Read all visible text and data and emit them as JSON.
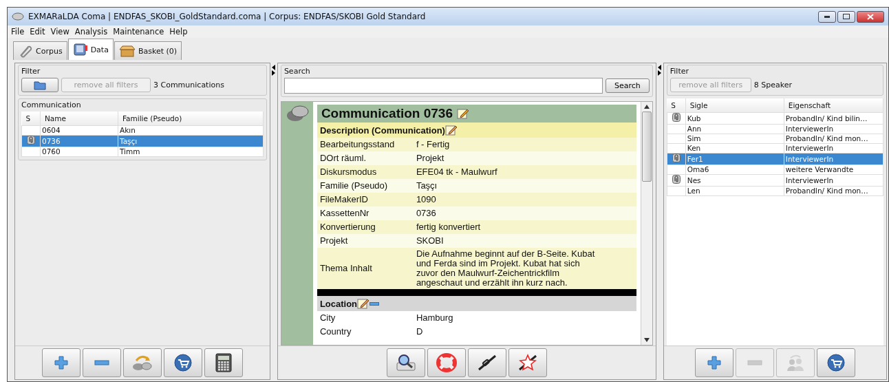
{
  "window": {
    "title": "EXMARaLDA Coma | ENDFAS_SKOBI_GoldStandard.coma | Corpus: ENDFAS/SKOBI Gold Standard"
  },
  "menu": [
    "File",
    "Edit",
    "View",
    "Analysis",
    "Maintenance",
    "Help"
  ],
  "tabs": [
    {
      "label": "Corpus",
      "kind": "clip",
      "selected": false
    },
    {
      "label": "Data",
      "kind": "book",
      "selected": true
    },
    {
      "label": "Basket (0)",
      "kind": "box",
      "selected": false
    }
  ],
  "left_panel": {
    "filter": {
      "title": "Filter",
      "remove_button": "remove all filters",
      "count": "3 Communications"
    },
    "communication": {
      "title": "Communication",
      "columns": [
        "S",
        "Name",
        "Familie (Pseudo)"
      ],
      "rows": [
        {
          "marked": false,
          "name": "0604",
          "family": "Akın",
          "selected": false
        },
        {
          "marked": true,
          "name": "0736",
          "family": "Taşçı",
          "selected": true
        },
        {
          "marked": false,
          "name": "0760",
          "family": "Timm",
          "selected": false
        }
      ]
    },
    "buttons": [
      {
        "kind": "add",
        "disabled": false
      },
      {
        "kind": "remove",
        "disabled": false
      },
      {
        "kind": "merge",
        "disabled": false
      },
      {
        "kind": "basket",
        "disabled": false
      },
      {
        "kind": "calculator",
        "disabled": false
      }
    ]
  },
  "center_panel": {
    "search": {
      "title": "Search",
      "button": "Search"
    },
    "detail": {
      "title": "Communication 0736",
      "sections": [
        {
          "kind": "description",
          "title": "Description (Communication)",
          "rows": [
            {
              "label": "Bearbeitungsstand",
              "value": "f - Fertig"
            },
            {
              "label": "DOrt räuml.",
              "value": "Projekt"
            },
            {
              "label": "Diskursmodus",
              "value": "EFE04 tk - Maulwurf"
            },
            {
              "label": "Familie (Pseudo)",
              "value": "Taşçı"
            },
            {
              "label": "FileMakerID",
              "value": "1090"
            },
            {
              "label": "KassettenNr",
              "value": "0736"
            },
            {
              "label": "Konvertierung",
              "value": "fertig konvertiert"
            },
            {
              "label": "Projekt",
              "value": "SKOBI"
            },
            {
              "label": "Thema Inhalt",
              "value": "Die Aufnahme beginnt auf der B-Seite. Kubat und Ferda sind im Projekt. Kubat hat sich zuvor den Maulwurf-Zeichentrickfilm angeschaut und erzählt ihn kurz nach."
            }
          ]
        },
        {
          "kind": "location",
          "title": "Location",
          "rows": [
            {
              "label": "City",
              "value": "Hamburg"
            },
            {
              "label": "Country",
              "value": "D"
            }
          ]
        }
      ]
    },
    "buttons": [
      {
        "kind": "search-doc",
        "disabled": false
      },
      {
        "kind": "lifebuoy",
        "disabled": false
      },
      {
        "kind": "chain",
        "disabled": false
      },
      {
        "kind": "broken-chain",
        "disabled": false
      }
    ]
  },
  "right_panel": {
    "filter": {
      "title": "Filter",
      "remove_button": "remove all filters",
      "count": "8 Speaker"
    },
    "columns": [
      "S",
      "Sigle",
      "Eigenschaft"
    ],
    "rows": [
      {
        "marked": true,
        "sigle": "Kub",
        "property": "ProbandIn/ Kind bilin…",
        "selected": false
      },
      {
        "marked": false,
        "sigle": "Ann",
        "property": "InterviewerIn",
        "selected": false
      },
      {
        "marked": false,
        "sigle": "Sim",
        "property": "ProbandIn/ Kind mon…",
        "selected": false
      },
      {
        "marked": false,
        "sigle": "Ken",
        "property": "InterviewerIn",
        "selected": false
      },
      {
        "marked": true,
        "sigle": "Fer1",
        "property": "InterviewerIn",
        "selected": true
      },
      {
        "marked": false,
        "sigle": "Oma6",
        "property": "weitere Verwandte",
        "selected": false
      },
      {
        "marked": true,
        "sigle": "Nes",
        "property": "InterviewerIn",
        "selected": false
      },
      {
        "marked": false,
        "sigle": "Len",
        "property": "ProbandIn/ Kind mon…",
        "selected": false
      }
    ],
    "buttons": [
      {
        "kind": "add",
        "disabled": false
      },
      {
        "kind": "remove",
        "disabled": true
      },
      {
        "kind": "people",
        "disabled": true
      },
      {
        "kind": "basket",
        "disabled": false
      }
    ]
  }
}
